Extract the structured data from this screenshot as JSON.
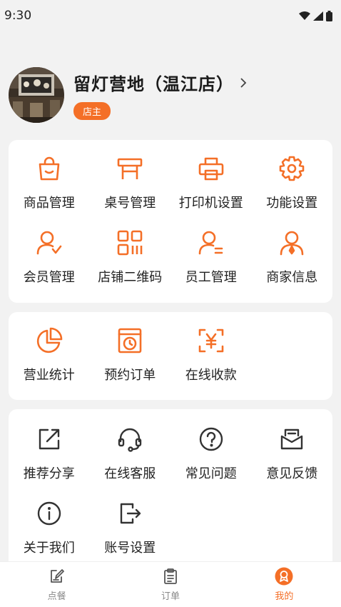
{
  "status": {
    "time": "9:30"
  },
  "profile": {
    "store_name": "留灯营地（温江店）",
    "role": "店主"
  },
  "colors": {
    "accent": "#f46f27",
    "text": "#222222",
    "background": "#f2f2f2"
  },
  "card1": {
    "items": [
      {
        "label": "商品管理",
        "icon": "shopping-bag-icon"
      },
      {
        "label": "桌号管理",
        "icon": "table-icon"
      },
      {
        "label": "打印机设置",
        "icon": "printer-icon"
      },
      {
        "label": "功能设置",
        "icon": "gear-icon"
      },
      {
        "label": "会员管理",
        "icon": "member-icon"
      },
      {
        "label": "店铺二维码",
        "icon": "qr-code-icon"
      },
      {
        "label": "员工管理",
        "icon": "staff-icon"
      },
      {
        "label": "商家信息",
        "icon": "merchant-icon"
      }
    ]
  },
  "card2": {
    "items": [
      {
        "label": "营业统计",
        "icon": "pie-chart-icon"
      },
      {
        "label": "预约订单",
        "icon": "reservation-icon"
      },
      {
        "label": "在线收款",
        "icon": "yuan-scan-icon"
      }
    ]
  },
  "card3": {
    "items": [
      {
        "label": "推荐分享",
        "icon": "share-icon"
      },
      {
        "label": "在线客服",
        "icon": "headset-icon"
      },
      {
        "label": "常见问题",
        "icon": "question-icon"
      },
      {
        "label": "意见反馈",
        "icon": "feedback-icon"
      },
      {
        "label": "关于我们",
        "icon": "info-icon"
      },
      {
        "label": "账号设置",
        "icon": "logout-icon"
      }
    ]
  },
  "tabs": [
    {
      "label": "点餐",
      "icon": "order-food-icon",
      "active": false
    },
    {
      "label": "订单",
      "icon": "clipboard-icon",
      "active": false
    },
    {
      "label": "我的",
      "icon": "profile-badge-icon",
      "active": true
    }
  ]
}
